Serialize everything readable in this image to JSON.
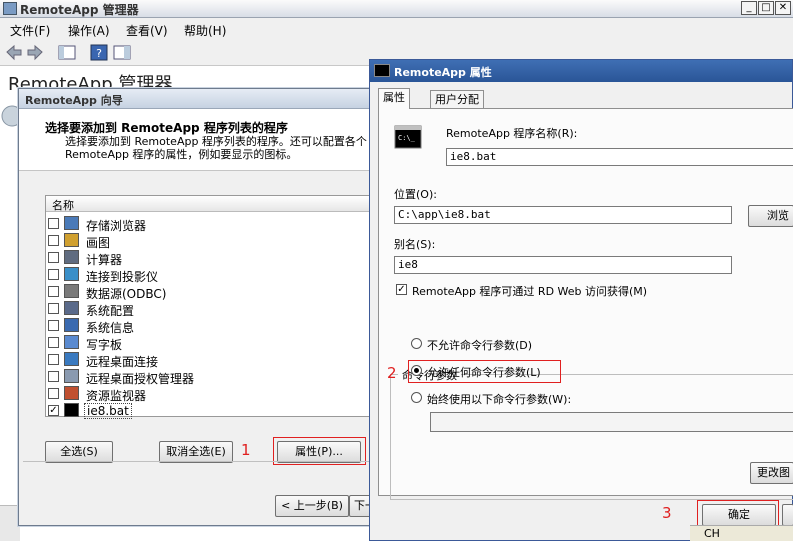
{
  "main_window": {
    "title": "RemoteApp 管理器",
    "menu": [
      "文件(F)",
      "操作(A)",
      "查看(V)",
      "帮助(H)"
    ],
    "heading": "RemoteApp 管理器"
  },
  "wizard": {
    "title": "RemoteApp 向导",
    "heading": "选择要添加到 RemoteApp 程序列表的程序",
    "description": "选择要添加到 RemoteApp 程序列表的程序。还可以配置各个 RemoteApp 程序的属性，例如要显示的图标。",
    "list_header": "名称",
    "programs": [
      {
        "label": "存储浏览器",
        "checked": false,
        "icon": "storage-explorer-icon"
      },
      {
        "label": "画图",
        "checked": false,
        "icon": "paint-icon"
      },
      {
        "label": "计算器",
        "checked": false,
        "icon": "calculator-icon"
      },
      {
        "label": "连接到投影仪",
        "checked": false,
        "icon": "projector-icon"
      },
      {
        "label": "数据源(ODBC)",
        "checked": false,
        "icon": "odbc-icon"
      },
      {
        "label": "系统配置",
        "checked": false,
        "icon": "system-config-icon"
      },
      {
        "label": "系统信息",
        "checked": false,
        "icon": "system-info-icon"
      },
      {
        "label": "写字板",
        "checked": false,
        "icon": "wordpad-icon"
      },
      {
        "label": "远程桌面连接",
        "checked": false,
        "icon": "remote-desktop-icon"
      },
      {
        "label": "远程桌面授权管理器",
        "checked": false,
        "icon": "licensing-manager-icon"
      },
      {
        "label": "资源监视器",
        "checked": false,
        "icon": "resource-monitor-icon"
      },
      {
        "label": "ie8.bat",
        "checked": true,
        "icon": "console-icon"
      }
    ],
    "select_all": "全选(S)",
    "deselect_all": "取消全选(E)",
    "properties": "属性(P)...",
    "back": "< 上一步(B)",
    "next": "下一"
  },
  "properties_dialog": {
    "title": "RemoteApp 属性",
    "tabs": [
      "属性",
      "用户分配"
    ],
    "program_name_label": "RemoteApp 程序名称(R):",
    "program_name_value": "ie8.bat",
    "location_label": "位置(O):",
    "location_value": "C:\\app\\ie8.bat",
    "browse": "浏览",
    "alias_label": "别名(S):",
    "alias_value": "ie8",
    "rdweb_checkbox": "RemoteApp 程序可通过 RD Web 访问获得(M)",
    "cmd_group": "命令行参数",
    "radio_options": [
      "不允许命令行参数(D)",
      "允许任何命令行参数(L)",
      "始终使用以下命令行参数(W):"
    ],
    "cmd_args_value": "",
    "change_icon": "更改图",
    "ok": "确定"
  },
  "annotations": [
    "1",
    "2",
    "3"
  ],
  "taskbar": {
    "lang": "CH"
  },
  "colors": {
    "annotation": "#e02020",
    "dialog_title": "#2a5597"
  }
}
